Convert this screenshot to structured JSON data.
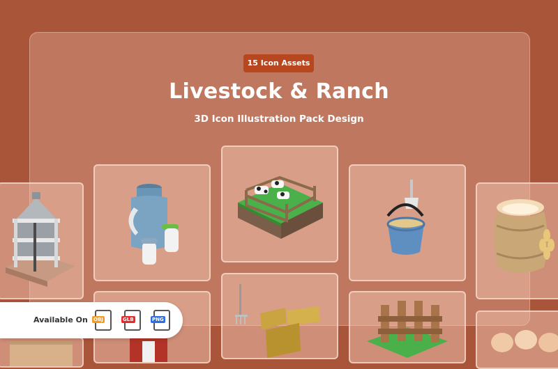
{
  "header": {
    "badge": "15 Icon Assets",
    "title": "Livestock & Ranch",
    "subtitle": "3D Icon Illustration Pack Design"
  },
  "available": {
    "label": "Available On",
    "formats": [
      {
        "name": "OBJ",
        "color": "#f39c1f"
      },
      {
        "name": "GLB",
        "color": "#e52b2b"
      },
      {
        "name": "PNG",
        "color": "#2f6fe0"
      }
    ]
  },
  "icons": [
    {
      "name": "grain-silo-icon"
    },
    {
      "name": "milk-can-icon"
    },
    {
      "name": "cattle-pen-icon"
    },
    {
      "name": "feed-bucket-icon"
    },
    {
      "name": "flour-sack-icon"
    },
    {
      "name": "hay-bales-icon"
    },
    {
      "name": "fence-icon"
    },
    {
      "name": "eggs-icon"
    }
  ]
}
